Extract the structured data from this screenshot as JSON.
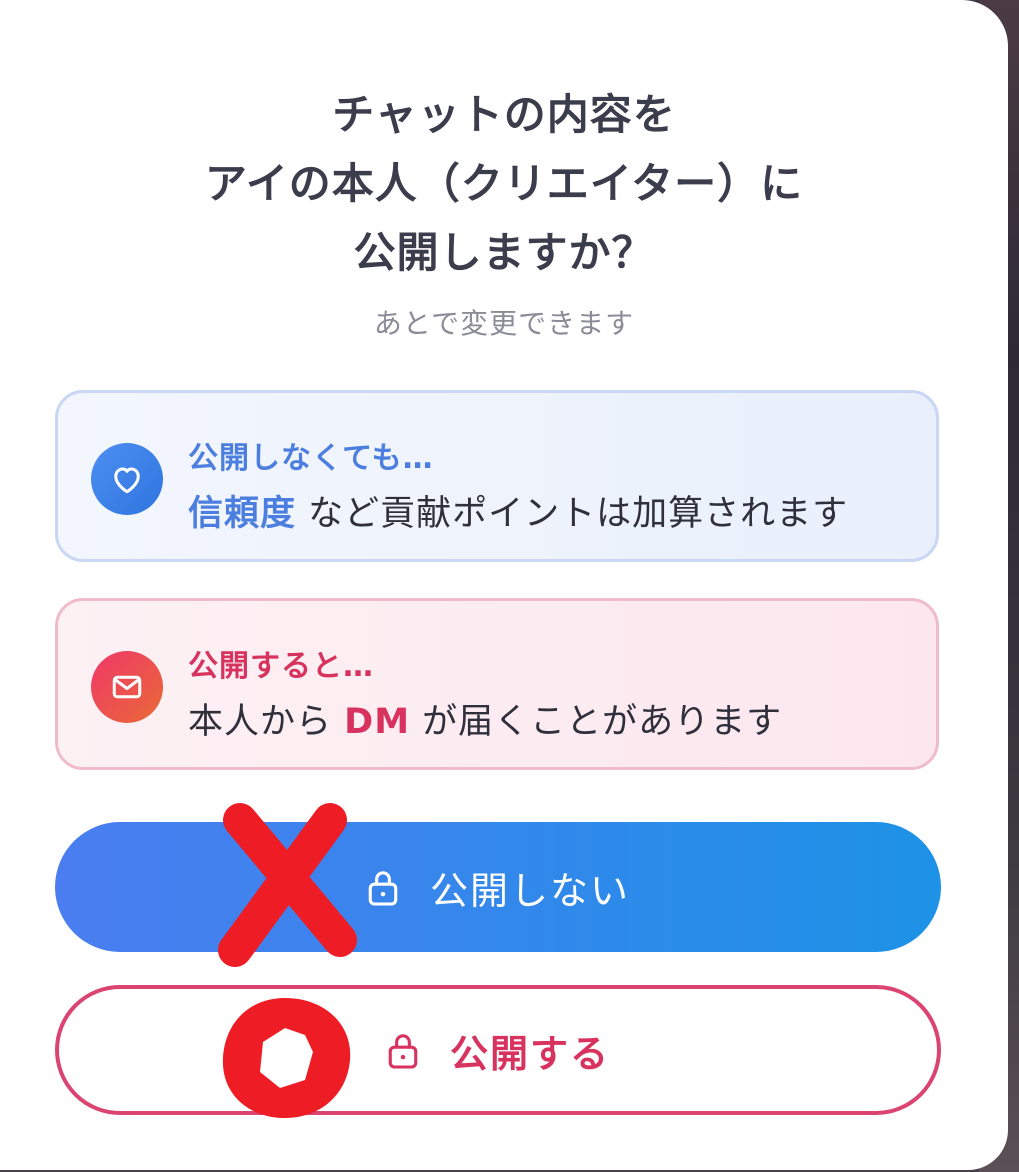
{
  "dialog": {
    "title_lines": [
      "チャットの内容を",
      "アイの本人（クリエイター）に",
      "公開しますか？"
    ],
    "subtitle": "あとで変更できます"
  },
  "cards": {
    "private_info": {
      "icon": "heart-icon",
      "heading": "公開しなくても…",
      "body_highlight": "信頼度",
      "body_rest": " など貢献ポイントは加算されます"
    },
    "public_info": {
      "icon": "mail-icon",
      "heading": "公開すると…",
      "body_pre": "本人から ",
      "body_highlight": "DM",
      "body_post": " が届くことがあります"
    }
  },
  "buttons": {
    "private_label": "公開しない",
    "public_label": "公開する",
    "icon": "lock-icon"
  },
  "annotations": {
    "x_mark": "red-x-mark",
    "o_mark": "red-circle-mark"
  },
  "colors": {
    "accent_blue": "#4a7df0",
    "accent_pink": "#d8335f",
    "annotation_red": "#ee1c25"
  }
}
